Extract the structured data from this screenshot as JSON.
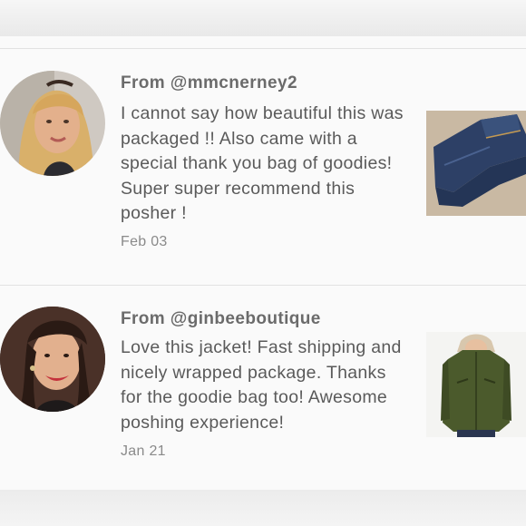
{
  "reviews": [
    {
      "from": "From @mmcnerney2",
      "text": "I cannot say how beautiful this was packaged !! Also came with a special thank you bag of goodies! Super super recommend this posher !",
      "date": "Feb 03",
      "avatar_icon": "user-avatar-photo",
      "thumb_icon": "jeans-product-photo"
    },
    {
      "from": "From @ginbeeboutique",
      "text": "Love this jacket! Fast shipping and nicely wrapped package. Thanks for the goodie bag too! Awesome poshing experience!",
      "date": "Jan 21",
      "avatar_icon": "user-avatar-photo",
      "thumb_icon": "jacket-product-photo"
    }
  ]
}
